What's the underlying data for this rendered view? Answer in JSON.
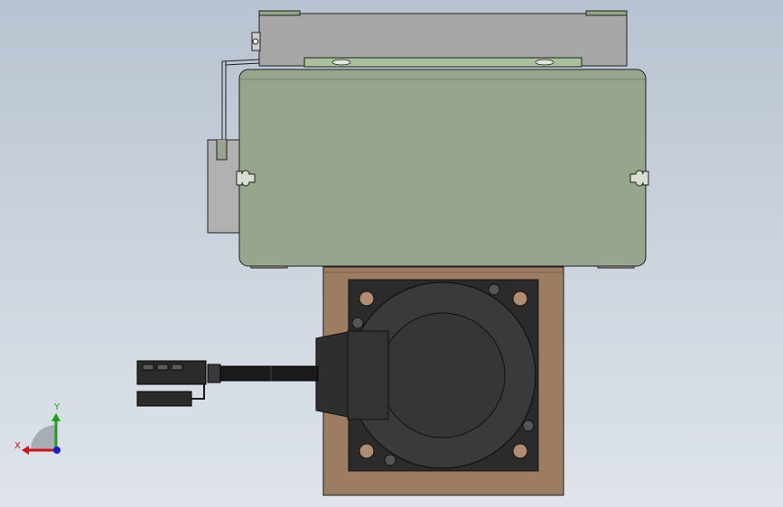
{
  "viewport": {
    "background_top": "#b8c3d1",
    "background_bottom": "#dfe4ea"
  },
  "colors": {
    "outline": "#1f1f1f",
    "cover_gray": "#a7a7a7",
    "rail_green": "#a9c19c",
    "body_green": "#97a58d",
    "bracket_gray": "#b1b1b1",
    "mount_brown": "#9c7d62",
    "flange_black": "#2b2b2b",
    "motor_dark": "#3a3a3a",
    "cable_black": "#1a1a1a",
    "axis_x": "#d0101a",
    "axis_y": "#1aa01a",
    "axis_z": "#1020d0"
  },
  "parts": {
    "top_cover": "top-cover",
    "guide_rail": "guide-rail",
    "carriage_body": "carriage-body",
    "side_bracket": "side-bracket",
    "motor_mount": "motor-mount",
    "servo_motor": "servo-motor",
    "motor_cable": "motor-cable",
    "cable_connector": "cable-connector"
  },
  "triad": {
    "x_label": "X",
    "y_label": "Y"
  }
}
